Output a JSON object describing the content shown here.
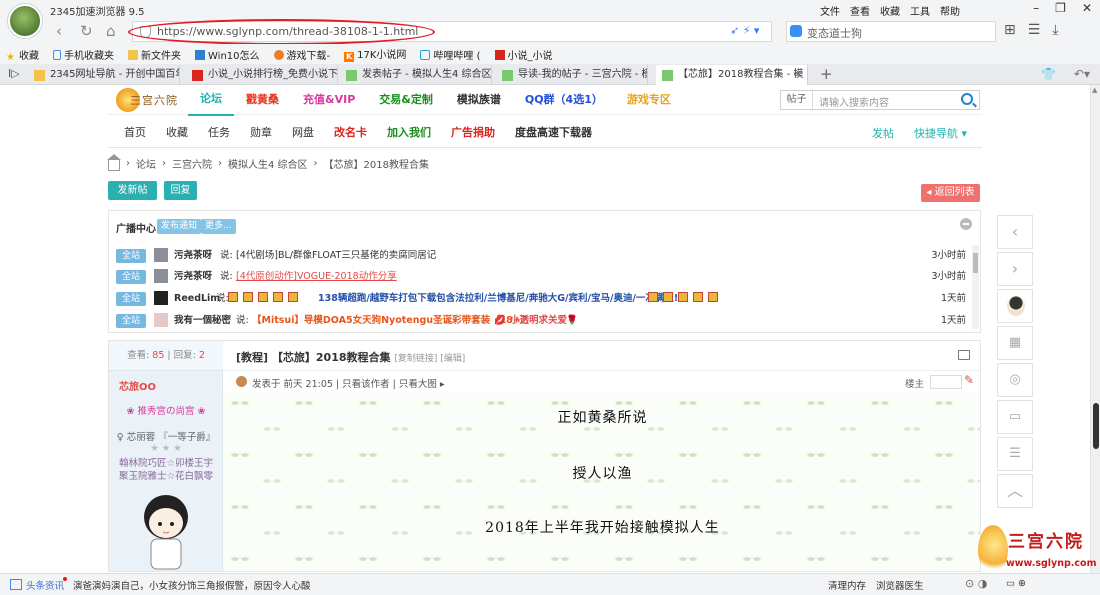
{
  "browser": {
    "title": "2345加速浏览器 9.5",
    "menu": [
      "文件",
      "查看",
      "收藏",
      "工具",
      "帮助"
    ],
    "url": "https://www.sglynp.com/thread-38108-1-1.html",
    "search_text": "变态道士狗",
    "bookmarks": [
      "收藏",
      "手机收藏夹",
      "新文件夹",
      "Win10怎么",
      "游戏下载-",
      "17K小说网",
      "哔哩哔哩 (",
      "小说_小说"
    ],
    "tabs": [
      {
        "label": "2345网址导航 - 开创中国百年"
      },
      {
        "label": "小说_小说排行榜_免费小说下载"
      },
      {
        "label": "发表帖子 - 模拟人生4 综合区"
      },
      {
        "label": "导读-我的帖子 - 三宫六院 - 模"
      },
      {
        "label": "【芯旅】2018教程合集 - 模",
        "active": true
      }
    ]
  },
  "site": {
    "logo_text": "三宫六院",
    "main_nav": [
      {
        "label": "论坛",
        "color": "#1fb4b4",
        "active": true
      },
      {
        "label": "戳黄桑",
        "color": "#e8341c"
      },
      {
        "label": "充值&VIP",
        "color": "#d63aa0"
      },
      {
        "label": "交易&定制",
        "color": "#1a8f1a"
      },
      {
        "label": "模拟族谱",
        "color": "#333333"
      },
      {
        "label": "QQ群（4选1）",
        "color": "#2550d8"
      },
      {
        "label": "游戏专区",
        "color": "#e8a21c"
      }
    ],
    "search_select": "帖子",
    "search_placeholder": "请输入搜索内容",
    "sub_nav": [
      {
        "label": "首页",
        "style": ""
      },
      {
        "label": "收藏",
        "style": ""
      },
      {
        "label": "任务",
        "style": ""
      },
      {
        "label": "勋章",
        "style": ""
      },
      {
        "label": "网盘",
        "style": ""
      },
      {
        "label": "改名卡",
        "style": "red"
      },
      {
        "label": "加入我们",
        "style": "green"
      },
      {
        "label": "广告捐助",
        "style": "red"
      },
      {
        "label": "度盘高速下载器",
        "style": "bold"
      }
    ],
    "post_link": "发帖",
    "quick_nav": "快捷导航 ▾"
  },
  "breadcrumb": [
    "论坛",
    "三宫六院",
    "模拟人生4 综合区",
    "【芯旅】2018教程合集"
  ],
  "buttons": {
    "new_post": "发新帖",
    "reply": "回复",
    "back_list": "◂ 返回列表"
  },
  "broadcast": {
    "title": "广播中心",
    "tags": [
      "发布通知",
      "更多..."
    ],
    "rows": [
      {
        "scope": "全站",
        "user": "污尧茶呀",
        "said": "说:",
        "msg": "[4代剧场]BL/群像FLOAT三只基佬的卖腐同居记",
        "style": "",
        "time": "3小时前"
      },
      {
        "scope": "全站",
        "user": "污尧茶呀",
        "said": "说:",
        "msg": "[4代原创动作]VOGUE-2018动作分享",
        "style": "red",
        "time": "3小时前"
      },
      {
        "scope": "全站",
        "user": "ReedLim",
        "said": "说:",
        "msg": "138辆超跑/越野车打包下载包含法拉利/兰博基尼/奔驰大G/宾利/宝马/奥迪/一次满足!",
        "style": "blue",
        "time": "1天前"
      },
      {
        "scope": "全站",
        "user": "我有一個秘密",
        "said": "说:",
        "msg": "【Mitsui】导模DOA5女天狗Nyotengu圣诞彩带套装（18+）",
        "msg2": "小透明求关爱",
        "style": "orange",
        "time": "1天前"
      }
    ]
  },
  "post": {
    "views_label": "查看:",
    "views": "85",
    "replies_label": "回复:",
    "replies": "2",
    "author": "芯旅OO",
    "rank_line": "❀ 推秀宫の尚宫 ❀",
    "title_line": "♀ 芯丽蓉 『一等子爵』",
    "stars": "★ ★ ★",
    "fav_line1": "翰林院巧匠☆卯楼王宇",
    "fav_line2": "聚玉院雅士☆花白飘零",
    "title": "[教程] 【芯旅】2018教程合集",
    "title_small": "[复制链接] [编辑]",
    "meta": "发表于 前天 21:05  |  只看该作者  |  只看大图 ▸",
    "floor": "楼主",
    "body": [
      "正如黄桑所说",
      "授人以渔",
      "2018年上半年我开始接触模拟人生"
    ]
  },
  "watermark": {
    "title": "三宫六院",
    "url": "www.sglynp.com"
  },
  "statusbar": {
    "news": "头条资讯",
    "ticker": "演爸演妈演自己，小女孩分饰三角报假警，原因令人心酸",
    "clean_mem": "清理内存",
    "doctor": "浏览器医生"
  }
}
